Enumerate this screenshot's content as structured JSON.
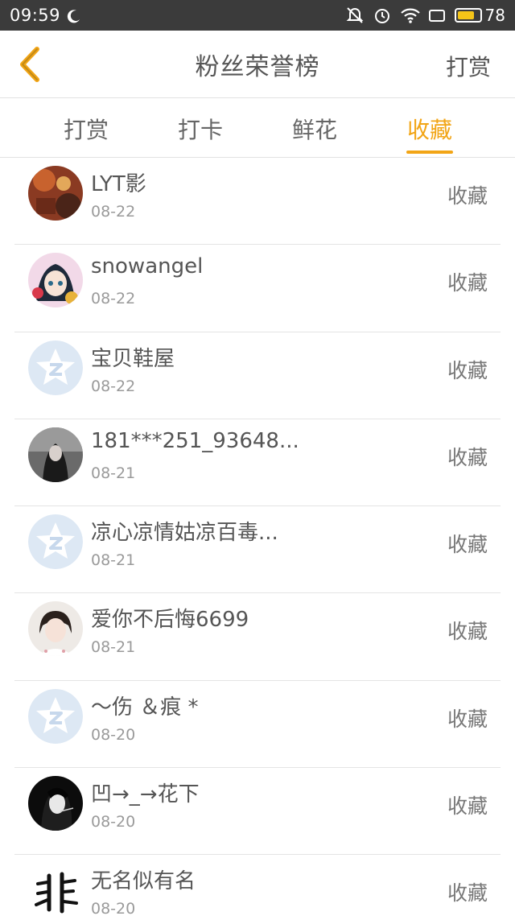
{
  "status_bar": {
    "time": "09:59",
    "battery": "78",
    "battery_level": 0.78
  },
  "header": {
    "title": "粉丝荣誉榜",
    "action_label": "打赏"
  },
  "tabs": [
    {
      "label": "打赏",
      "active": false
    },
    {
      "label": "打卡",
      "active": false
    },
    {
      "label": "鲜花",
      "active": false
    },
    {
      "label": "收藏",
      "active": true
    }
  ],
  "accent_color": "#f2a516",
  "fans": [
    {
      "name": "LYT影",
      "date": "08-22",
      "action": "收藏",
      "avatar": "photo-red"
    },
    {
      "name": "snowangel",
      "date": "08-22",
      "action": "收藏",
      "avatar": "anime-girl"
    },
    {
      "name": "宝贝鞋屋",
      "date": "08-22",
      "action": "收藏",
      "avatar": "default-star"
    },
    {
      "name": "181***251_93648...",
      "date": "08-21",
      "action": "收藏",
      "avatar": "photo-dark"
    },
    {
      "name": "凉心凉情姑凉百毒...",
      "date": "08-21",
      "action": "收藏",
      "avatar": "default-star"
    },
    {
      "name": "爱你不后悔6699",
      "date": "08-21",
      "action": "收藏",
      "avatar": "photo-girl"
    },
    {
      "name": "～伤 ＆痕 *",
      "date": "08-20",
      "action": "收藏",
      "avatar": "default-star"
    },
    {
      "name": "凹→_→花下",
      "date": "08-20",
      "action": "收藏",
      "avatar": "photo-bw"
    },
    {
      "name": "无名似有名",
      "date": "08-20",
      "action": "收藏",
      "avatar": "calligraphy"
    }
  ]
}
